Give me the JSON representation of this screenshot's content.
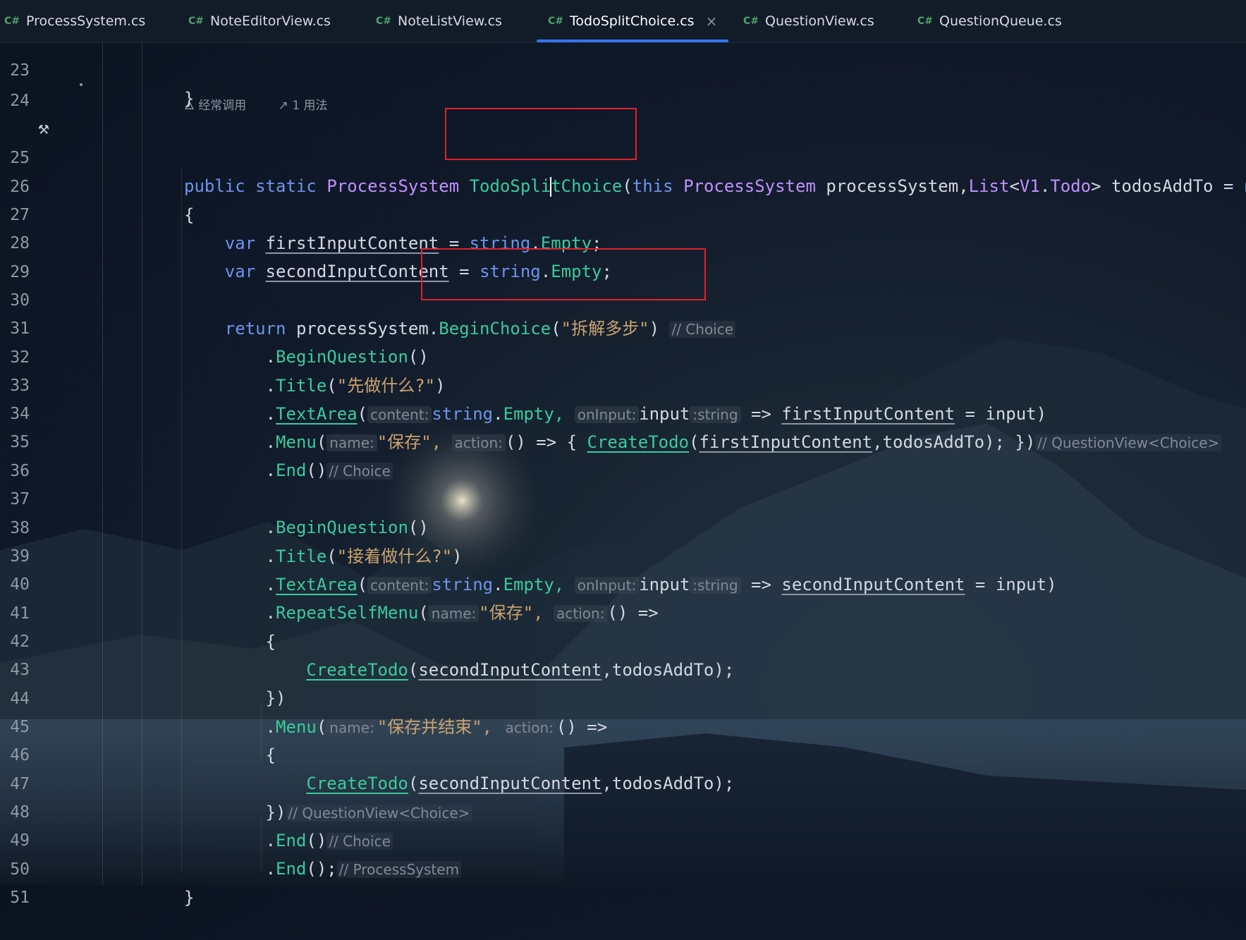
{
  "tabs": [
    {
      "lang": "C#",
      "label": "ProcessSystem.cs"
    },
    {
      "lang": "C#",
      "label": "NoteEditorView.cs"
    },
    {
      "lang": "C#",
      "label": "NoteListView.cs"
    },
    {
      "lang": "C#",
      "label": "TodoSplitChoice.cs",
      "active": true
    },
    {
      "lang": "C#",
      "label": "QuestionView.cs"
    },
    {
      "lang": "C#",
      "label": "QuestionQueue.cs"
    }
  ],
  "close_glyph": "×",
  "code_lens": {
    "usage_hint": "经常调用",
    "usages": "1 用法"
  },
  "line_numbers": [
    "23",
    "24",
    "25",
    "26",
    "27",
    "28",
    "29",
    "30",
    "31",
    "32",
    "33",
    "34",
    "35",
    "36",
    "37",
    "38",
    "39",
    "40",
    "41",
    "42",
    "43",
    "44",
    "45",
    "46",
    "47",
    "48",
    "49",
    "50",
    "51"
  ],
  "code": {
    "l23": "}",
    "l25": {
      "kw1": "public",
      "kw2": "static",
      "ret": "ProcessSystem",
      "name_a": "TodoSpli",
      "name_b": "tChoice",
      "open": "(",
      "this": "this",
      "ptype": "ProcessSystem",
      "pname": "processSystem,",
      "ltype": "List",
      "lt": "<",
      "ns": "V1",
      "dot": ".",
      "todo": "Todo",
      "gt": ">",
      "p2": "todosAddTo",
      "eq": "=",
      "null": "null"
    },
    "l26": "{",
    "l27": {
      "kw": "var",
      "name": "firstInputContent",
      "eq": "=",
      "s": "string",
      "dot": ".",
      "empty": "Empty",
      ";": ";"
    },
    "l28": {
      "kw": "var",
      "name": "secondInputContent",
      "eq": "=",
      "s": "string",
      "dot": ".",
      "empty": "Empty",
      ";": ";"
    },
    "l30": {
      "kw": "return",
      "obj": "processSystem",
      "dot": ".",
      "fn": "BeginChoice",
      "open": "(",
      "str": "\"拆解多步\"",
      "close": ")",
      "cm": "// Choice"
    },
    "l31": {
      "dot": ".",
      "fn": "BeginQuestion",
      "rest": "()"
    },
    "l32": {
      "dot": ".",
      "fn": "Title",
      "open": "(",
      "str": "\"先做什么?\"",
      "close": ")"
    },
    "l33": {
      "dot": ".",
      "fn": "TextArea",
      "open": "(",
      "h1": "content:",
      "s": "string",
      "dot2": ".",
      "empty": "Empty,",
      "h2": "onInput:",
      "inp": "input",
      "h3": ":string",
      "arrow": "=>",
      "var": "firstInputContent",
      "eq": "=",
      "rest": "input)"
    },
    "l34": {
      "dot": ".",
      "fn": "Menu",
      "open": "(",
      "h1": "name:",
      "str": "\"保存\",",
      "h2": "action:",
      "rest": "() => {",
      "call": "CreateTodo",
      "args_a": "(",
      "args_var": "firstInputContent",
      "args_b": ",todosAddTo); })",
      "cm": "// QuestionView<Choice>"
    },
    "l35": {
      "dot": ".",
      "fn": "End",
      "rest": "()",
      "cm": "// Choice"
    },
    "l37": {
      "dot": ".",
      "fn": "BeginQuestion",
      "rest": "()"
    },
    "l38": {
      "dot": ".",
      "fn": "Title",
      "open": "(",
      "str": "\"接着做什么?\"",
      "close": ")"
    },
    "l39": {
      "dot": ".",
      "fn": "TextArea",
      "open": "(",
      "h1": "content:",
      "s": "string",
      "dot2": ".",
      "empty": "Empty,",
      "h2": "onInput:",
      "inp": "input",
      "h3": ":string",
      "arrow": "=>",
      "var": "secondInputContent",
      "eq": "=",
      "rest": "input)"
    },
    "l40": {
      "dot": ".",
      "fn": "RepeatSelfMenu",
      "open": "(",
      "h1": "name:",
      "str": "\"保存\",",
      "h2": "action:",
      "rest": "() =>"
    },
    "l41": "{",
    "l42": {
      "call": "CreateTodo",
      "a": "(",
      "var": "secondInputContent",
      "b": ",todosAddTo);"
    },
    "l43": "})",
    "l44": {
      "dot": ".",
      "fn": "Menu",
      "open": "(",
      "h1": "name:",
      "str": "\"保存并结束\",",
      "h2": "action:",
      "rest": "() =>"
    },
    "l45": "{",
    "l46": {
      "call": "CreateTodo",
      "a": "(",
      "var": "secondInputContent",
      "b": ",todosAddTo);"
    },
    "l47": {
      "rest": "})",
      "cm": "// QuestionView<Choice>"
    },
    "l48": {
      "dot": ".",
      "fn": "End",
      "rest": "()",
      "cm": "// Choice"
    },
    "l49": {
      "dot": ".",
      "fn": "End",
      "rest": "();",
      "cm": "// ProcessSystem"
    },
    "l50": "}"
  }
}
